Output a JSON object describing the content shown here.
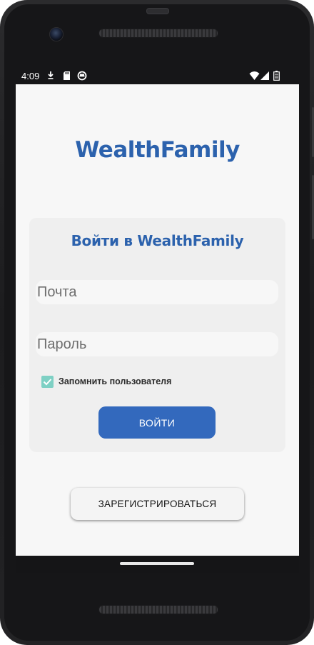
{
  "status_bar": {
    "time": "4:09",
    "icons": [
      "download-icon",
      "sd-card-icon",
      "sync-icon",
      "wifi-icon",
      "signal-icon",
      "battery-icon"
    ]
  },
  "app": {
    "title": "WealthFamily",
    "accent_color": "#2c62ad"
  },
  "login_card": {
    "title": "Войти в WealthFamily",
    "email_placeholder": "Почта",
    "password_placeholder": "Пароль",
    "remember_label": "Запомнить пользователя",
    "remember_checked": true,
    "remember_color": "#7ed0c4",
    "login_label": "ВОЙТИ",
    "login_color": "#3369bd"
  },
  "register_label": "ЗАРЕГИСТРИРОВАТЬСЯ"
}
